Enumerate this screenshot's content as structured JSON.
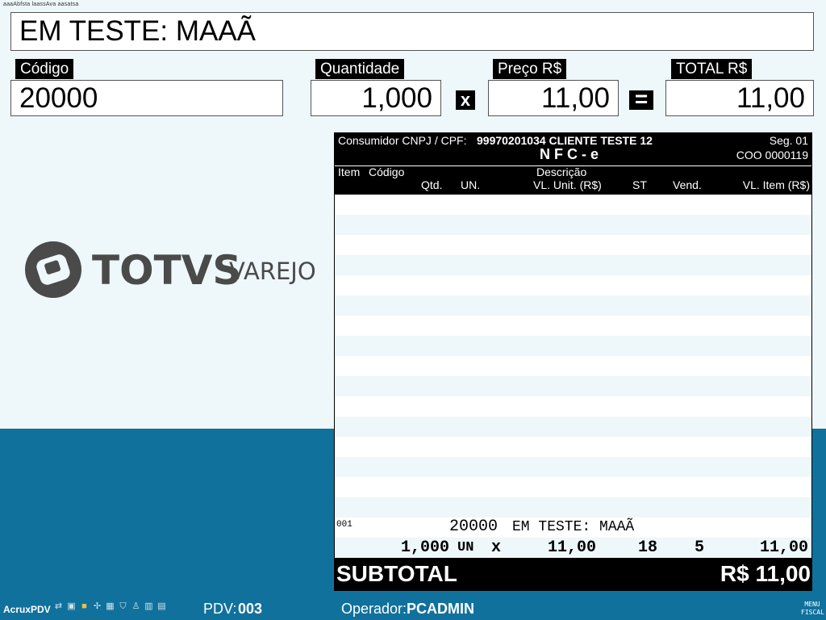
{
  "top_caption": "aaaAbfsta laassAva aasatsa",
  "product_description": "EM TESTE: MAAÃ",
  "fields": {
    "codigo": {
      "label": "Código",
      "value": "20000"
    },
    "quantidade": {
      "label": "Quantidade",
      "value": "1,000"
    },
    "multiply_symbol": "x",
    "preco": {
      "label": "Preço R$",
      "value": "11,00"
    },
    "equals_symbol": "=",
    "total": {
      "label": "TOTAL R$",
      "value": "11,00"
    }
  },
  "logo": {
    "brand": "TOTVS",
    "product": "VAREJO"
  },
  "receipt": {
    "consumer_label": "Consumidor CNPJ / CPF:",
    "consumer_value": "99970201034 CLIENTE TESTE 12",
    "segment": "Seg. 01",
    "doc_type": "N F C - e",
    "coo": "COO 0000119",
    "columns": {
      "item": "Item",
      "codigo": "Código",
      "descricao": "Descrição",
      "qtd": "Qtd.",
      "un": "UN.",
      "vl_unit": "VL. Unit. (R$)",
      "st": "ST",
      "vend": "Vend.",
      "vl_item": "VL. Item (R$)"
    },
    "items": [
      {
        "item": "001",
        "codigo": "20000",
        "descricao": "EM TESTE: MAAÃ",
        "qtd": "1,000",
        "un": "UN",
        "x": "x",
        "vl_unit": "11,00",
        "st": "18",
        "vend": "5",
        "vl_item": "11,00"
      }
    ],
    "subtotal_label": "SUBTOTAL",
    "subtotal_value": "R$ 11,00"
  },
  "status_bar": {
    "app": "AcruxPDV",
    "icons": [
      "network-icon",
      "monitor-icon",
      "printer-icon",
      "scanner-icon",
      "keyboard-icon",
      "shield-icon",
      "scale-icon",
      "drawer-icon",
      "barcode-icon"
    ],
    "pdv_label": "PDV:",
    "pdv_value": "003",
    "operator_label": "Operador:",
    "operator_value": "PCADMIN",
    "menu_line1": "MENU",
    "menu_line2": "FISCAL"
  },
  "colors": {
    "background": "#eef7fa",
    "band": "#10719c",
    "logo": "#4a4a4a"
  }
}
